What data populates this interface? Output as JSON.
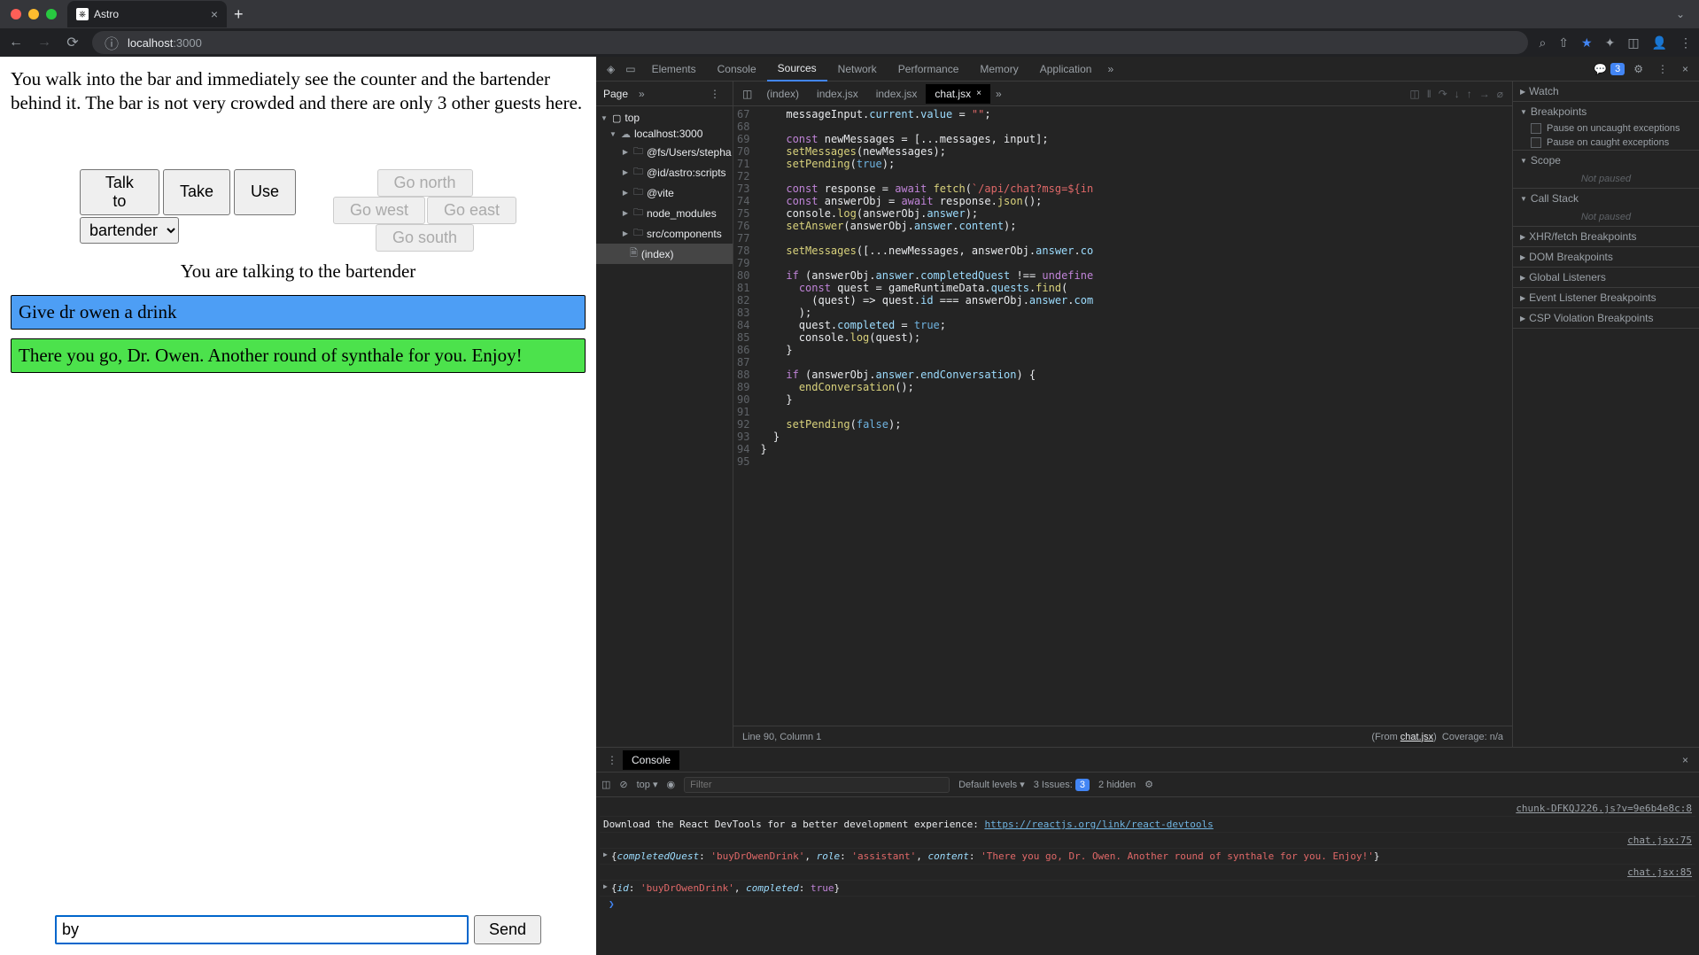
{
  "browser": {
    "tab_title": "Astro",
    "url_host": "localhost",
    "url_port": ":3000"
  },
  "game": {
    "narrative": "You walk into the bar and immediately see the counter and the bartender behind it. The bar is not very crowded and there are only 3 other guests here.",
    "actions": {
      "talk_to": "Talk to",
      "take": "Take",
      "use": "Use"
    },
    "select_value": "bartender",
    "directions": {
      "north": "Go north",
      "west": "Go west",
      "east": "Go east",
      "south": "Go south"
    },
    "talking_to": "You are talking to the bartender",
    "messages": [
      {
        "role": "user",
        "text": "Give dr owen a drink"
      },
      {
        "role": "ai",
        "text": "There you go, Dr. Owen. Another round of synthale for you. Enjoy!"
      }
    ],
    "input_value": "by",
    "send_label": "Send"
  },
  "devtools": {
    "tabs": [
      "Elements",
      "Console",
      "Sources",
      "Network",
      "Performance",
      "Memory",
      "Application"
    ],
    "active_tab": "Sources",
    "issues_count": "3",
    "sources": {
      "page_tab": "Page",
      "tree": {
        "top": "top",
        "host": "localhost:3000",
        "folders": [
          "@fs/Users/stepha",
          "@id/astro:scripts",
          "@vite",
          "node_modules",
          "src/components"
        ],
        "file": "(index)"
      },
      "file_tabs": [
        "(index)",
        "index.jsx",
        "index.jsx",
        "chat.jsx"
      ],
      "active_file": "chat.jsx",
      "line_numbers": [
        "67",
        "68",
        "69",
        "70",
        "71",
        "72",
        "73",
        "74",
        "75",
        "76",
        "77",
        "78",
        "79",
        "80",
        "81",
        "82",
        "83",
        "84",
        "85",
        "86",
        "87",
        "88",
        "89",
        "90",
        "91",
        "92",
        "93",
        "94",
        "95"
      ],
      "status_line": "Line 90, Column 1",
      "status_from": "(From ",
      "status_from_file": "chat.jsx",
      "status_from_end": ")",
      "coverage": "Coverage: n/a"
    },
    "debugger": {
      "sections": {
        "watch": "Watch",
        "breakpoints": "Breakpoints",
        "pause_uncaught": "Pause on uncaught exceptions",
        "pause_caught": "Pause on caught exceptions",
        "scope": "Scope",
        "not_paused": "Not paused",
        "call_stack": "Call Stack",
        "xhr_bp": "XHR/fetch Breakpoints",
        "dom_bp": "DOM Breakpoints",
        "global_listeners": "Global Listeners",
        "event_bp": "Event Listener Breakpoints",
        "csp_bp": "CSP Violation Breakpoints"
      }
    },
    "console": {
      "tab": "Console",
      "context": "top",
      "filter_placeholder": "Filter",
      "levels": "Default levels",
      "issues_label": "3 Issues:",
      "issues_num": "3",
      "hidden": "2 hidden",
      "src1": "chunk-DFKQJ226.js?v=9e6b4e8c:8",
      "msg1_pre": "Download the React DevTools for a better development experience: ",
      "msg1_link": "https://reactjs.org/link/react-devtools",
      "src2": "chat.jsx:75",
      "msg2": "{completedQuest: 'buyDrOwenDrink', role: 'assistant', content: 'There you go, Dr. Owen. Another round of synthale for you. Enjoy!'}",
      "src3": "chat.jsx:85",
      "msg3": "{id: 'buyDrOwenDrink', completed: true}"
    }
  }
}
